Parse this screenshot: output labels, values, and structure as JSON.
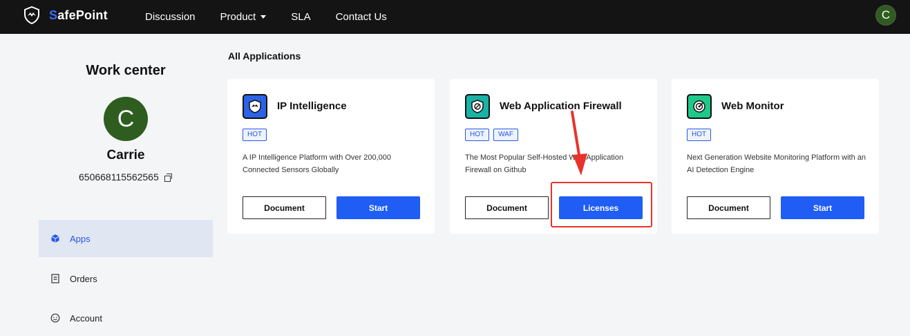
{
  "nav": {
    "brand_initial": "S",
    "brand_rest": "afePoint",
    "items": [
      "Discussion",
      "Product",
      "SLA",
      "Contact Us"
    ],
    "avatar_letter": "C"
  },
  "sidebar": {
    "title": "Work center",
    "avatar_letter": "C",
    "user_name": "Carrie",
    "user_id": "650668115562565",
    "menu": [
      {
        "label": "Apps",
        "icon": "cube-icon",
        "active": true
      },
      {
        "label": "Orders",
        "icon": "document-icon",
        "active": false
      },
      {
        "label": "Account",
        "icon": "smiley-icon",
        "active": false
      }
    ]
  },
  "main": {
    "section_title": "All Applications",
    "cards": [
      {
        "title": "IP Intelligence",
        "icon": "shield-icon",
        "tags": [
          "HOT"
        ],
        "description": "A IP Intelligence Platform with Over 200,000 Connected Sensors Globally",
        "doc_label": "Document",
        "action_label": "Start"
      },
      {
        "title": "Web Application Firewall",
        "icon": "firewall-icon",
        "tags": [
          "HOT",
          "WAF"
        ],
        "description": "The Most Popular Self-Hosted Web Application Firewall on Github",
        "doc_label": "Document",
        "action_label": "Licenses"
      },
      {
        "title": "Web Monitor",
        "icon": "monitor-icon",
        "tags": [
          "HOT"
        ],
        "description": "Next Generation Website Monitoring Platform with an AI Detection Engine",
        "doc_label": "Document",
        "action_label": "Start"
      }
    ]
  },
  "colors": {
    "accent": "#1f5df5",
    "topbar": "#141414",
    "avatar": "#2e5d1f",
    "highlight": "#e8332a"
  }
}
